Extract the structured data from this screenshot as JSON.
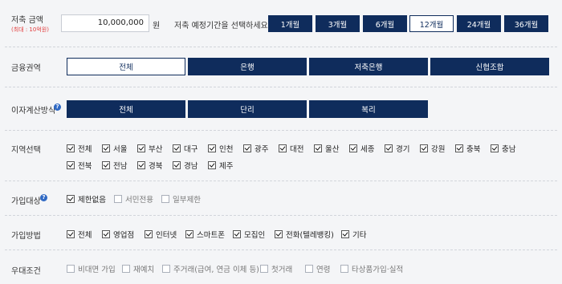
{
  "amount": {
    "label": "저축 금액",
    "note": "(최대 : 10억원)",
    "value": "10,000,000",
    "unit": "원"
  },
  "period": {
    "label": "저축 예정기간을 선택하세요",
    "options": [
      "1개월",
      "3개월",
      "6개월",
      "12개월",
      "24개월",
      "36개월"
    ],
    "selected": "12개월"
  },
  "sector": {
    "label": "금융권역",
    "options": [
      "전체",
      "은행",
      "저축은행",
      "신협조합"
    ],
    "selected": "전체"
  },
  "interest": {
    "label": "이자계산방식",
    "help_icon": "question-icon",
    "help_glyph": "?",
    "options": [
      "전체",
      "단리",
      "복리"
    ]
  },
  "region": {
    "label": "지역선택",
    "row1": [
      "전체",
      "서울",
      "부산",
      "대구",
      "인천",
      "광주",
      "대전",
      "울산",
      "세종",
      "경기",
      "강원",
      "충북",
      "충남"
    ],
    "row2": [
      "전북",
      "전남",
      "경북",
      "경남",
      "제주"
    ]
  },
  "target": {
    "label": "가입대상",
    "help_glyph": "?",
    "options": [
      {
        "text": "제한없음",
        "checked": true
      },
      {
        "text": "서민전용",
        "checked": false
      },
      {
        "text": "일부제한",
        "checked": false
      }
    ]
  },
  "method": {
    "label": "가입방법",
    "options": [
      "전체",
      "영업점",
      "인터넷",
      "스마트폰",
      "모집인",
      "전화(텔레뱅킹)",
      "기타"
    ]
  },
  "pref": {
    "label": "우대조건",
    "options": [
      "비대면 가입",
      "재예치",
      "주거래(급여, 연금 이체 등)",
      "첫거래",
      "연령",
      "타상품가입·실적"
    ]
  },
  "colors": {
    "navy": "#0f2c5c",
    "background": "#f4f5f7",
    "help": "#2f69c4",
    "note_red": "#e23b3b"
  }
}
